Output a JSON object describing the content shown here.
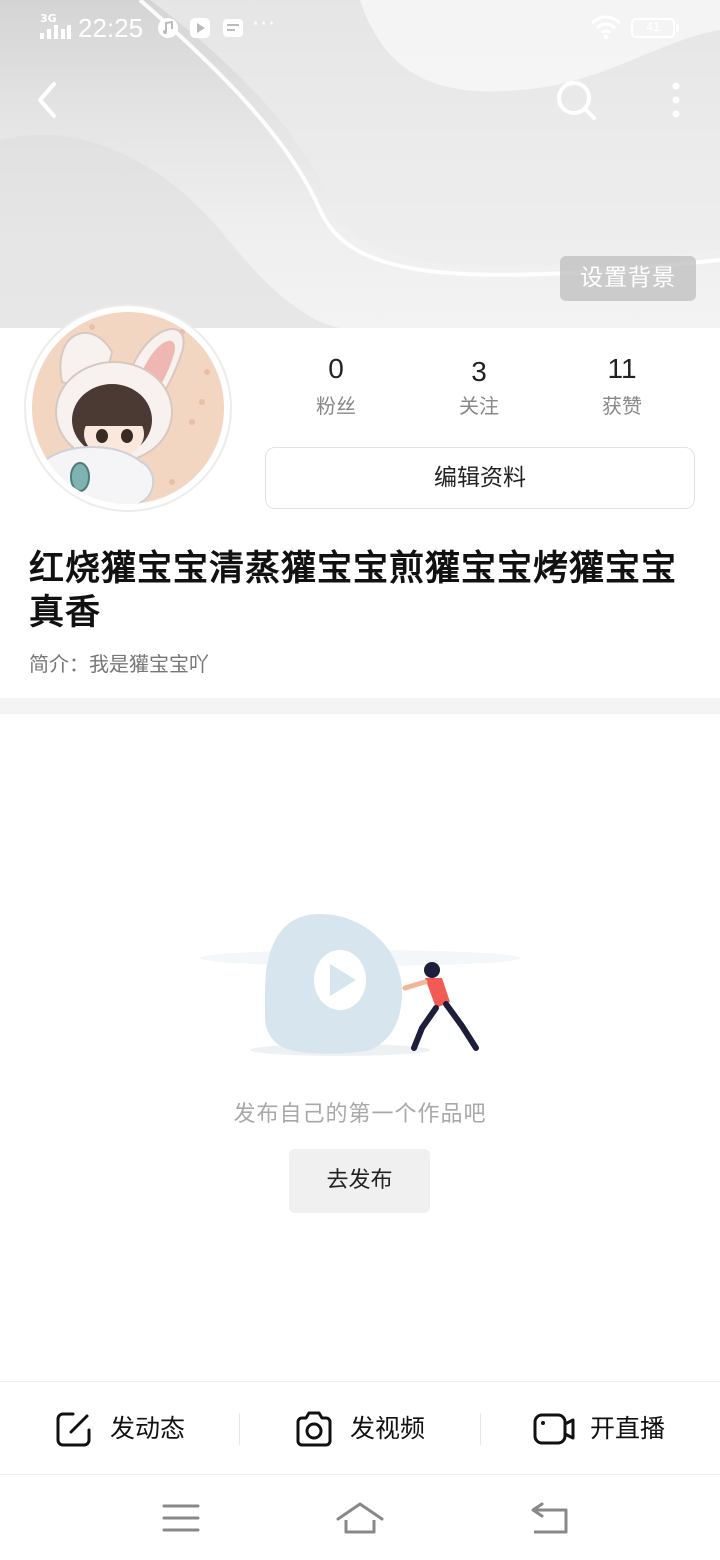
{
  "status_bar": {
    "network": "3G",
    "time": "22:25",
    "battery": "41",
    "icons": [
      "signal-icon",
      "music-icon",
      "video-play-icon",
      "message-icon",
      "more-dots-icon",
      "wifi-icon",
      "battery-icon"
    ],
    "more": "···"
  },
  "header": {
    "back_icon": "back-arrow-icon",
    "search_icon": "search-icon",
    "more_icon": "vertical-dots-icon",
    "set_background_label": "设置背景"
  },
  "profile": {
    "stats": [
      {
        "value": "0",
        "label": "粉丝"
      },
      {
        "value": "3",
        "label": "关注"
      },
      {
        "value": "11",
        "label": "获赞"
      }
    ],
    "edit_label": "编辑资料",
    "nickname": "红烧獾宝宝清蒸獾宝宝煎獾宝宝烤獾宝宝真香",
    "bio": "简介：我是獾宝宝吖"
  },
  "empty_state": {
    "message": "发布自己的第一个作品吧",
    "publish_label": "去发布"
  },
  "action_bar": [
    {
      "icon": "edit-post-icon",
      "label": "发动态"
    },
    {
      "icon": "camera-icon",
      "label": "发视频"
    },
    {
      "icon": "live-camera-icon",
      "label": "开直播"
    }
  ],
  "system_nav": {
    "icons": [
      "menu-icon",
      "home-icon",
      "back-icon"
    ]
  },
  "colors": {
    "banner": "#e6e6e6",
    "text_primary": "#111111",
    "text_secondary": "#888888",
    "button_bg": "#f0f0f0",
    "divider": "#f4f4f4"
  }
}
